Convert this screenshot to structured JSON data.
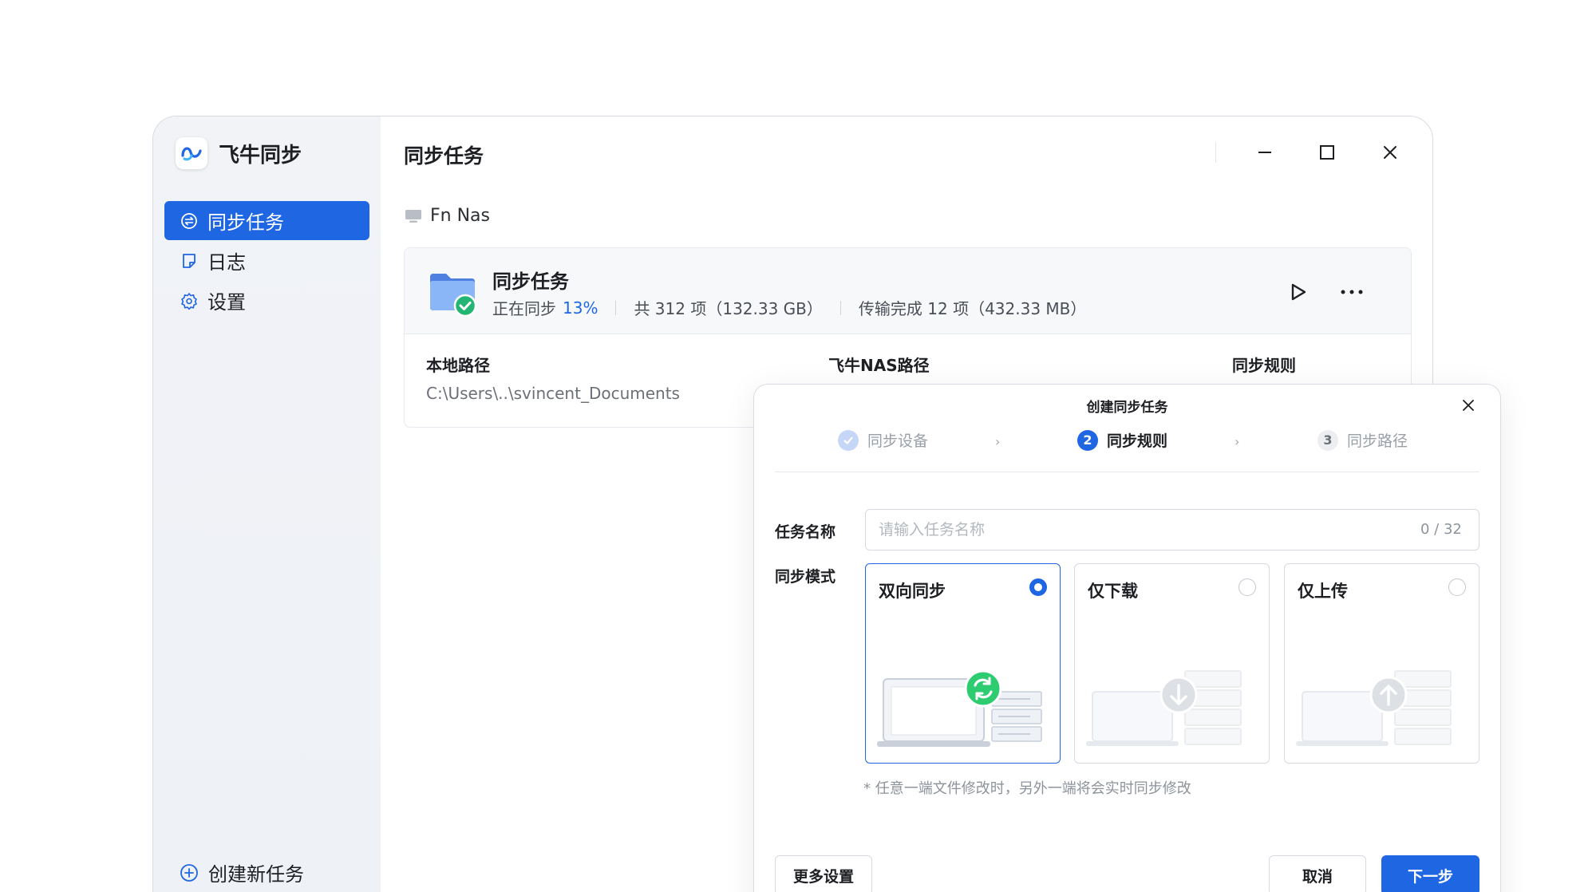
{
  "app": {
    "name": "飞牛同步"
  },
  "sidebar": {
    "items": [
      {
        "label": "同步任务",
        "icon": "sync-task-icon",
        "active": true
      },
      {
        "label": "日志",
        "icon": "log-icon",
        "active": false
      },
      {
        "label": "设置",
        "icon": "gear-icon",
        "active": false
      }
    ],
    "create_label": "创建新任务"
  },
  "main": {
    "title": "同步任务",
    "device": "Fn Nas",
    "task": {
      "name": "同步任务",
      "status": "正在同步",
      "progress": "13%",
      "total": "共 312 项（132.33 GB）",
      "transferred": "传输完成 12 项（432.33 MB）",
      "columns": [
        {
          "label": "本地路径",
          "value": "C:\\Users\\..\\svincent_Documents"
        },
        {
          "label": "飞牛NAS路径",
          "value": ""
        },
        {
          "label": "同步规则",
          "value": ""
        }
      ]
    }
  },
  "dialog": {
    "title": "创建同步任务",
    "steps": [
      {
        "num": "✓",
        "label": "同步设备",
        "state": "done"
      },
      {
        "num": "2",
        "label": "同步规则",
        "state": "current"
      },
      {
        "num": "3",
        "label": "同步路径",
        "state": "todo"
      }
    ],
    "name_label": "任务名称",
    "name_placeholder": "请输入任务名称",
    "name_counter": "0 / 32",
    "mode_label": "同步模式",
    "modes": [
      {
        "title": "双向同步",
        "selected": true
      },
      {
        "title": "仅下载",
        "selected": false
      },
      {
        "title": "仅上传",
        "selected": false
      }
    ],
    "hint": "* 任意一端文件修改时，另外一端将会实时同步修改",
    "more_settings": "更多设置",
    "cancel": "取消",
    "next": "下一步"
  },
  "colors": {
    "accent": "#1f66e3",
    "success": "#22b573",
    "sync_green": "#2ecc71"
  }
}
